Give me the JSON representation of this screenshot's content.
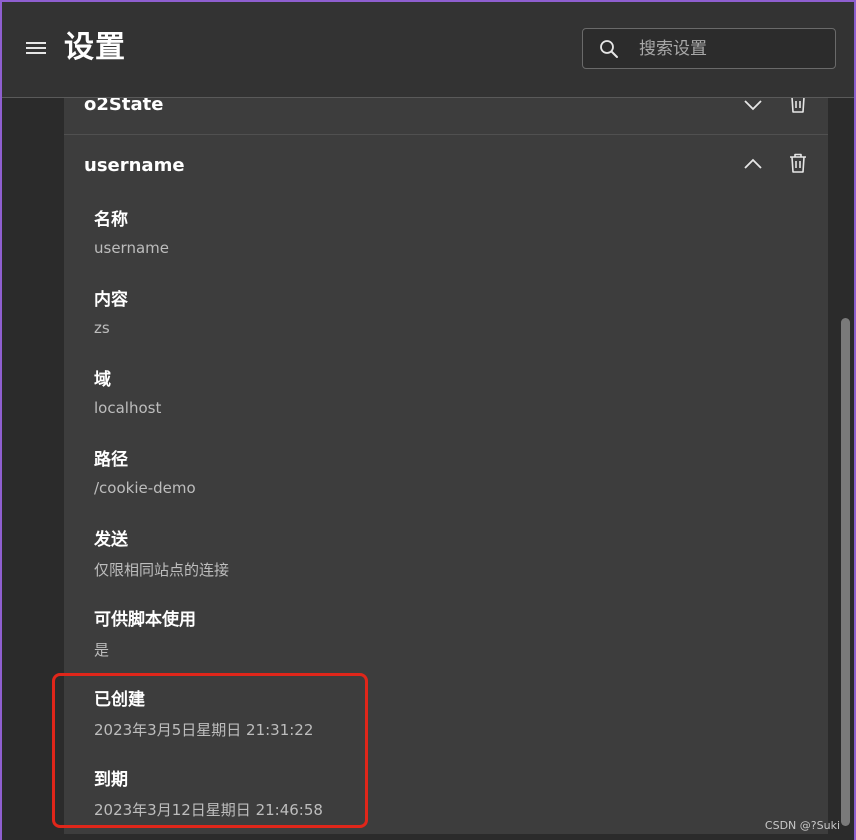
{
  "header": {
    "title": "设置",
    "search_placeholder": "搜索设置",
    "search_value": ""
  },
  "cookies": [
    {
      "name": "o2State",
      "expanded": false
    },
    {
      "name": "username",
      "expanded": true,
      "fields": [
        {
          "label": "名称",
          "value": "username"
        },
        {
          "label": "内容",
          "value": "zs"
        },
        {
          "label": "域",
          "value": "localhost"
        },
        {
          "label": "路径",
          "value": "/cookie-demo"
        },
        {
          "label": "发送",
          "value": "仅限相同站点的连接"
        },
        {
          "label": "可供脚本使用",
          "value": "是"
        },
        {
          "label": "已创建",
          "value": "2023年3月5日星期日 21:31:22"
        },
        {
          "label": "到期",
          "value": "2023年3月12日星期日 21:46:58"
        }
      ]
    }
  ],
  "icons": {
    "menu": "hamburger-menu-icon",
    "search": "search-icon",
    "expand": "chevron-down-icon",
    "collapse": "chevron-up-icon",
    "delete": "trash-icon"
  },
  "colors": {
    "background": "#2b2b2b",
    "header": "#333333",
    "panel": "#3d3d3d",
    "highlight": "#e0261a",
    "window_border": "#8f5fd0"
  },
  "watermark": "CSDN @?Suki"
}
